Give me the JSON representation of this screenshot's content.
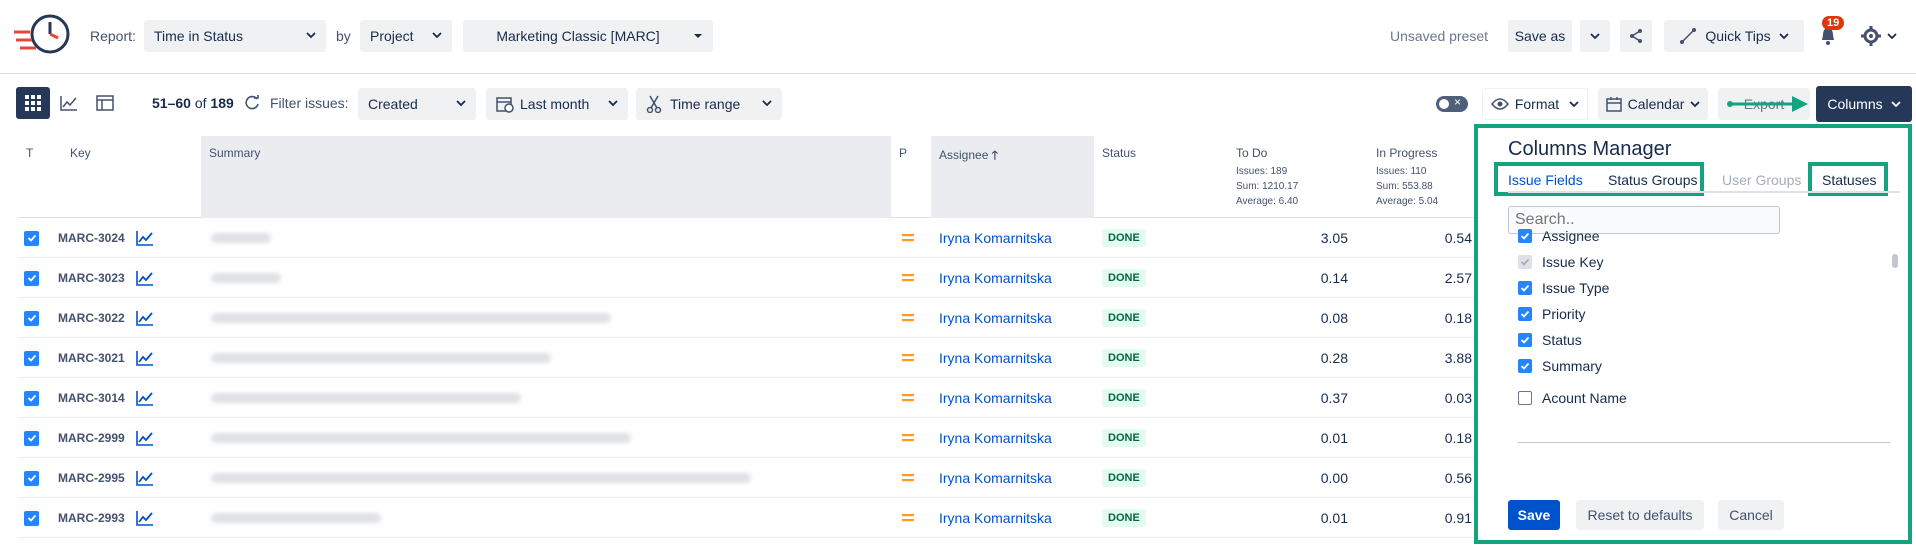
{
  "header": {
    "report_label": "Report:",
    "report_value": "Time in Status",
    "by_label": "by",
    "by_value": "Project",
    "project_value": "Marketing Classic [MARC]",
    "unsaved_preset": "Unsaved preset",
    "save_as": "Save as",
    "quick_tips": "Quick Tips",
    "notif_count": "19"
  },
  "toolbar": {
    "range_start": "51–60",
    "range_of": "of",
    "range_total": "189",
    "filter_label": "Filter issues:",
    "filter_value": "Created",
    "period_value": "Last month",
    "time_range": "Time range",
    "format": "Format",
    "calendar": "Calendar",
    "export": "Export",
    "columns": "Columns"
  },
  "table": {
    "headers": {
      "t": "T",
      "key": "Key",
      "summary": "Summary",
      "p": "P",
      "assignee": "Assignee",
      "status": "Status",
      "todo": "To Do",
      "todo_issues": "Issues: 189",
      "todo_sum": "Sum: 1210.17",
      "todo_avg": "Average: 6.40",
      "inprog": "In Progress",
      "inprog_issues": "Issues: 110",
      "inprog_sum": "Sum: 553.88",
      "inprog_avg": "Average: 5.04"
    },
    "rows": [
      {
        "key": "MARC-3024",
        "assignee": "Iryna Komarnitska",
        "status": "DONE",
        "todo": "3.05",
        "inprog": "0.54"
      },
      {
        "key": "MARC-3023",
        "assignee": "Iryna Komarnitska",
        "status": "DONE",
        "todo": "0.14",
        "inprog": "2.57"
      },
      {
        "key": "MARC-3022",
        "assignee": "Iryna Komarnitska",
        "status": "DONE",
        "todo": "0.08",
        "inprog": "0.18"
      },
      {
        "key": "MARC-3021",
        "assignee": "Iryna Komarnitska",
        "status": "DONE",
        "todo": "0.28",
        "inprog": "3.88"
      },
      {
        "key": "MARC-3014",
        "assignee": "Iryna Komarnitska",
        "status": "DONE",
        "todo": "0.37",
        "inprog": "0.03"
      },
      {
        "key": "MARC-2999",
        "assignee": "Iryna Komarnitska",
        "status": "DONE",
        "todo": "0.01",
        "inprog": "0.18"
      },
      {
        "key": "MARC-2995",
        "assignee": "Iryna Komarnitska",
        "status": "DONE",
        "todo": "0.00",
        "inprog": "0.56"
      },
      {
        "key": "MARC-2993",
        "assignee": "Iryna Komarnitska",
        "status": "DONE",
        "todo": "0.01",
        "inprog": "0.91"
      }
    ]
  },
  "columns_manager": {
    "title": "Columns Manager",
    "tabs": [
      "Issue Fields",
      "Status Groups",
      "User Groups",
      "Statuses"
    ],
    "search_placeholder": "Search..",
    "options": [
      {
        "label": "Assignee",
        "state": "on"
      },
      {
        "label": "Issue Key",
        "state": "dis"
      },
      {
        "label": "Issue Type",
        "state": "on"
      },
      {
        "label": "Priority",
        "state": "on"
      },
      {
        "label": "Status",
        "state": "on"
      },
      {
        "label": "Summary",
        "state": "on"
      },
      {
        "label": "Acount Name",
        "state": "off"
      }
    ],
    "save": "Save",
    "reset": "Reset to defaults",
    "cancel": "Cancel"
  },
  "colors": {
    "accent": "#0052cc",
    "highlight": "#14a37f",
    "dark": "#253858",
    "badge": "#de350b"
  }
}
